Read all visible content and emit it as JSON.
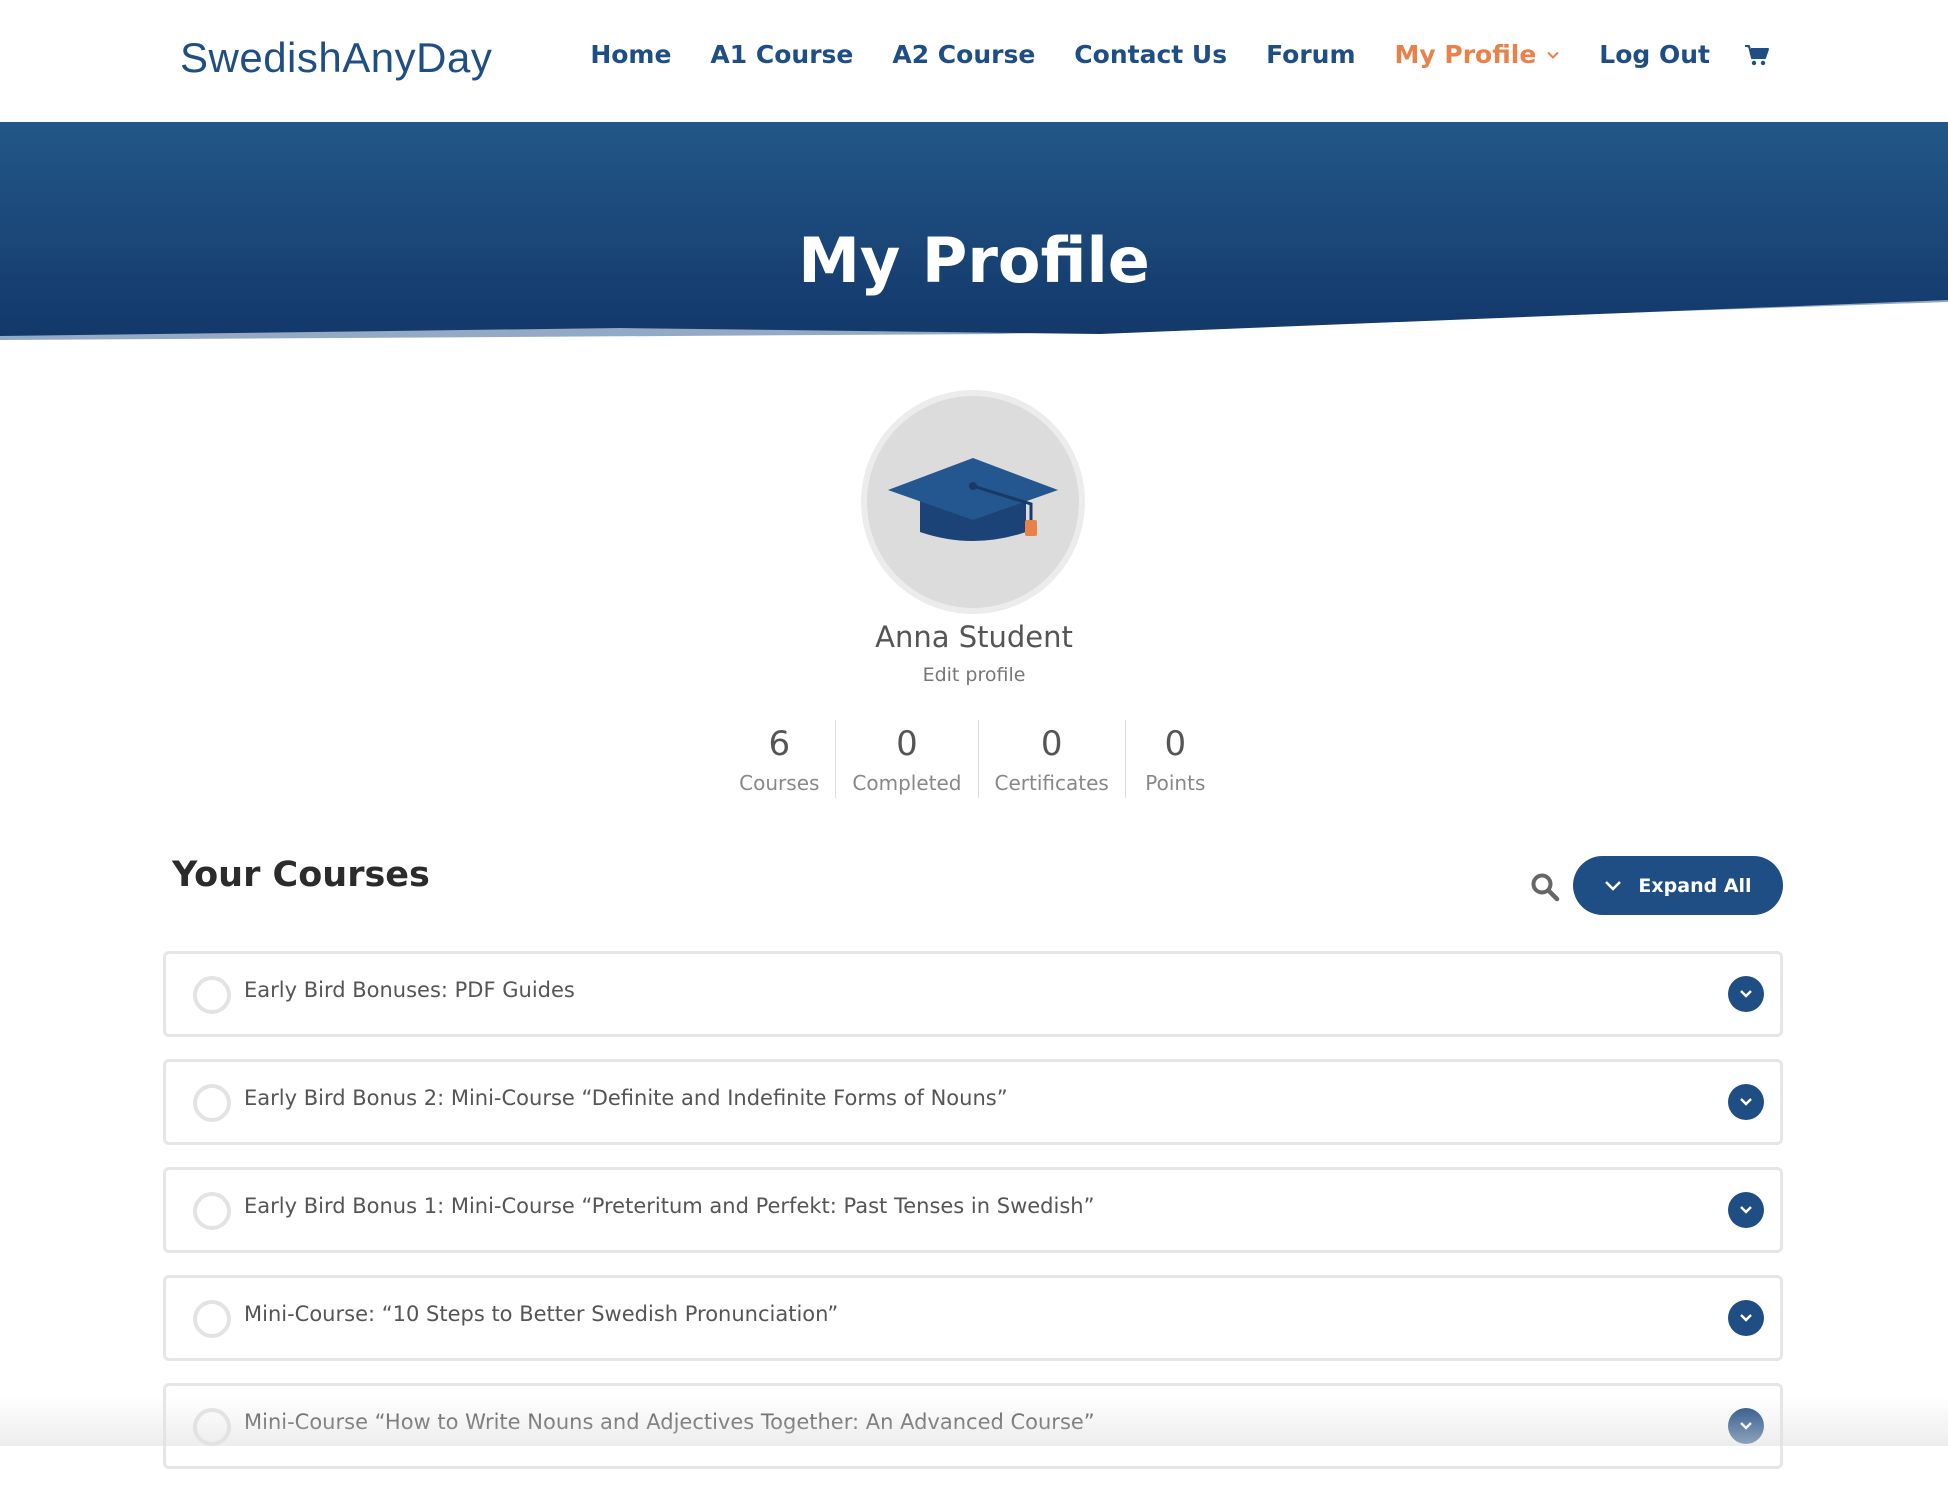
{
  "brand": {
    "logo_text": "SwedishAnyDay"
  },
  "nav": {
    "items": [
      {
        "label": "Home",
        "active": false
      },
      {
        "label": "A1 Course",
        "active": false
      },
      {
        "label": "A2 Course",
        "active": false
      },
      {
        "label": "Contact Us",
        "active": false
      },
      {
        "label": "Forum",
        "active": false
      },
      {
        "label": "My Profile",
        "active": true,
        "has_dropdown": true
      },
      {
        "label": "Log Out",
        "active": false
      }
    ],
    "cart_icon": "cart-icon"
  },
  "hero": {
    "title": "My Profile"
  },
  "profile": {
    "name": "Anna Student",
    "edit_link": "Edit profile",
    "avatar_icon": "graduation-cap-icon",
    "stats": [
      {
        "value": "6",
        "label": "Courses"
      },
      {
        "value": "0",
        "label": "Completed"
      },
      {
        "value": "0",
        "label": "Certificates"
      },
      {
        "value": "0",
        "label": "Points"
      }
    ]
  },
  "courses": {
    "heading": "Your Courses",
    "expand_all_label": "Expand All",
    "items": [
      {
        "title": "Early Bird Bonuses: PDF Guides"
      },
      {
        "title": "Early Bird Bonus 2: Mini-Course “Definite and Indefinite Forms of Nouns”"
      },
      {
        "title": "Early Bird Bonus 1: Mini-Course “Preteritum and Perfekt: Past Tenses in Swedish”"
      },
      {
        "title": "Mini-Course: “10 Steps to Better Swedish Pronunciation”"
      },
      {
        "title": "Mini-Course “How to Write Nouns and Adjectives Together: An Advanced Course”"
      }
    ]
  },
  "colors": {
    "primary": "#1f4e85",
    "accent": "#e8814a",
    "hero_dark": "#153d6e"
  }
}
